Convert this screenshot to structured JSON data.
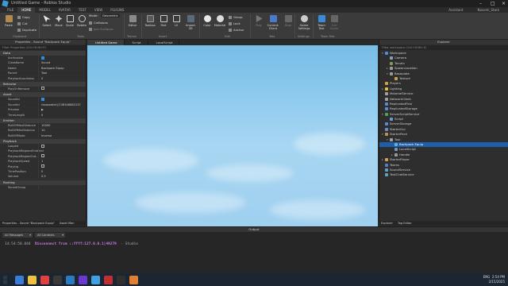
{
  "window": {
    "title": "Untitled Game - Roblox Studio"
  },
  "ribbon_tabs": [
    "FILE",
    "HOME",
    "MODEL",
    "AVATAR",
    "TEST",
    "VIEW",
    "PLUGINS"
  ],
  "ribbon_right": {
    "assistant": "Assistant",
    "user": "Nasomi_Stark"
  },
  "ribbon": {
    "clipboard": {
      "paste": "Paste",
      "copy": "Copy",
      "cut": "Cut",
      "duplicate": "Duplicate",
      "label": "Clipboard"
    },
    "tools": {
      "select": "Select",
      "move": "Move",
      "scale": "Scale",
      "rotate": "Rotate",
      "mode_label": "Mode:",
      "mode_value": "Geometric",
      "collisions": "Collisions",
      "join_surfaces": "Join Surfaces",
      "label": "Tools"
    },
    "terrain": {
      "editor": "Editor",
      "label": "Terrain"
    },
    "insert": {
      "toolbox": "Toolbox",
      "part": "Part",
      "ui": "UI",
      "import3d": "Import 3D",
      "label": "Insert"
    },
    "edit": {
      "color": "Color",
      "material": "Material",
      "group": "Group",
      "lock": "Lock",
      "anchor": "Anchor",
      "label": "Edit"
    },
    "test": {
      "play": "Play",
      "current_client": "Current: Client",
      "stop": "Stop",
      "label": "Test"
    },
    "settings": {
      "game_settings": "Game Settings",
      "label": "Settings"
    },
    "team_test": {
      "team_test": "Team Test",
      "exit_game": "Exit Game",
      "label": "Team Test"
    }
  },
  "properties": {
    "header": "Properties - Sound \"Backpack Equip\"",
    "filter_placeholder": "Filter Properties (Ctrl+Shift+P)",
    "sections": [
      {
        "name": "Data",
        "rows": [
          {
            "key": "Archivable",
            "value": "",
            "checkbox": "on"
          },
          {
            "key": "ClassName",
            "value": "Sound"
          },
          {
            "key": "Name",
            "value": "Backpack Equip"
          },
          {
            "key": "Parent",
            "value": "Tool"
          },
          {
            "key": "PlaybackLoudness",
            "value": "0"
          }
        ]
      },
      {
        "name": "Behavior",
        "rows": [
          {
            "key": "PlayOnRemove",
            "value": "",
            "checkbox": "off"
          }
        ]
      },
      {
        "name": "Asset",
        "rows": [
          {
            "key": "SoundId",
            "value": "",
            "checkbox": "on"
          },
          {
            "key": "SoundId",
            "value": "rbxassetid://138346883137"
          },
          {
            "key": "Preview",
            "value": "▶"
          },
          {
            "key": "TimeLength",
            "value": "0"
          }
        ]
      },
      {
        "name": "Emitter",
        "rows": [
          {
            "key": "RollOffMaxDistance",
            "value": "10000"
          },
          {
            "key": "RollOffMinDistance",
            "value": "10"
          },
          {
            "key": "RollOffMode",
            "value": "Inverse"
          }
        ]
      },
      {
        "name": "Playback",
        "rows": [
          {
            "key": "Looped",
            "value": "",
            "checkbox": "off"
          },
          {
            "key": "PlaybackRegionsEnabled",
            "value": ""
          },
          {
            "key": "PlaybackRegionEnd...",
            "value": "",
            "checkbox": "off"
          },
          {
            "key": "PlaybackSpeed",
            "value": "1"
          },
          {
            "key": "Playing",
            "value": "",
            "checkbox": "off"
          },
          {
            "key": "TimePosition",
            "value": "0"
          },
          {
            "key": "Volume",
            "value": "0.5"
          }
        ]
      },
      {
        "name": "Routing",
        "rows": [
          {
            "key": "SoundGroup",
            "value": ""
          }
        ]
      }
    ],
    "bottom_tabs": [
      "Properties - Sound \"Backpack Equip\"",
      "Asset Man"
    ]
  },
  "doc_tabs": [
    "Untitled Game",
    "Script",
    "LocalScript"
  ],
  "explorer": {
    "header": "Explorer",
    "filter_placeholder": "Filter workspace (Ctrl+Shift+X)",
    "items": [
      {
        "label": "Workspace",
        "indent": 0,
        "arrow": "▾",
        "color": "#4a8fd8"
      },
      {
        "label": "Camera",
        "indent": 2,
        "arrow": "",
        "color": "#8aa0b8"
      },
      {
        "label": "Terrain",
        "indent": 2,
        "arrow": "",
        "color": "#7a9a5a"
      },
      {
        "label": "SpawnLocation",
        "indent": 2,
        "arrow": "▸",
        "color": "#9a9a9a"
      },
      {
        "label": "Baseplate",
        "indent": 2,
        "arrow": "▾",
        "color": "#9a9a9a"
      },
      {
        "label": "Texture",
        "indent": 4,
        "arrow": "",
        "color": "#c9a24a"
      },
      {
        "label": "Players",
        "indent": 0,
        "arrow": "",
        "color": "#d8a040"
      },
      {
        "label": "Lighting",
        "indent": 0,
        "arrow": "▸",
        "color": "#e0c040"
      },
      {
        "label": "MaterialService",
        "indent": 0,
        "arrow": "",
        "color": "#a0a0a0"
      },
      {
        "label": "NetworkClient",
        "indent": 0,
        "arrow": "",
        "color": "#a0a0a0"
      },
      {
        "label": "ReplicatedFirst",
        "indent": 0,
        "arrow": "",
        "color": "#5a8ad0"
      },
      {
        "label": "ReplicatedStorage",
        "indent": 0,
        "arrow": "",
        "color": "#5a8ad0"
      },
      {
        "label": "ServerScriptService",
        "indent": 0,
        "arrow": "▾",
        "color": "#50a060"
      },
      {
        "label": "Script",
        "indent": 2,
        "arrow": "",
        "color": "#6a9ad0"
      },
      {
        "label": "ServerStorage",
        "indent": 0,
        "arrow": "",
        "color": "#5a8ad0"
      },
      {
        "label": "StarterGui",
        "indent": 0,
        "arrow": "",
        "color": "#6a8ad8"
      },
      {
        "label": "StarterPack",
        "indent": 0,
        "arrow": "▾",
        "color": "#c09050"
      },
      {
        "label": "Tool",
        "indent": 2,
        "arrow": "▾",
        "color": "#a0a0a0"
      },
      {
        "label": "Backpack Equip",
        "indent": 4,
        "arrow": "",
        "color": "#60b0e0",
        "selected": true
      },
      {
        "label": "LocalScript",
        "indent": 4,
        "arrow": "",
        "color": "#6a9ad0"
      },
      {
        "label": "Handle",
        "indent": 4,
        "arrow": "▸",
        "color": "#9a9a9a"
      },
      {
        "label": "StarterPlayer",
        "indent": 0,
        "arrow": "▸",
        "color": "#d0a050"
      },
      {
        "label": "Teams",
        "indent": 0,
        "arrow": "",
        "color": "#5080c0"
      },
      {
        "label": "SoundService",
        "indent": 0,
        "arrow": "",
        "color": "#60a0c0"
      },
      {
        "label": "TextChatService",
        "indent": 0,
        "arrow": "",
        "color": "#60a0c0"
      }
    ],
    "bottom_tabs": [
      "Explorer",
      "Tag Editor"
    ]
  },
  "output": {
    "header": "Output",
    "filter_messages": "All Messages",
    "filter_contexts": "All Contexts",
    "time": "14:54:58.844",
    "message": "Disconnect from ::ffff:127.0.0.1|49279",
    "source": "- Studio"
  },
  "taskbar": {
    "icons": [
      "#3a7bd5",
      "#f0c040",
      "#e04040",
      "#3a3a3a",
      "#2a7ac0",
      "#6a3ad0",
      "#40a0e0",
      "#c03030",
      "#303030",
      "#e08030"
    ],
    "lang": "ENG",
    "time": "2:54 PM",
    "date": "2/15/2025"
  }
}
